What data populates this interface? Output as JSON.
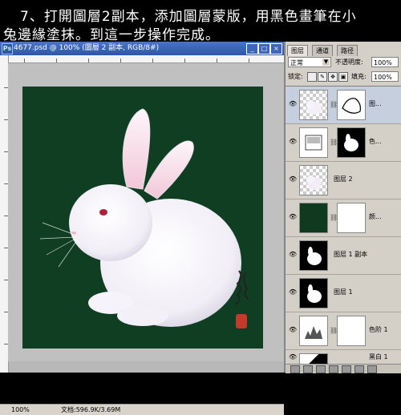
{
  "caption": {
    "line1": "7、打開圖層2副本，添加圖層蒙版，用黑色畫筆在小",
    "line2": "兔邊緣塗抹。到這一步操作完成。"
  },
  "document": {
    "title": "4677.psd @ 100% (圖層 2 副本, RGB/8#)",
    "zoom": "100%",
    "doc_info": "文档:596.9K/3.69M",
    "canvas_color": "#103e23"
  },
  "panel": {
    "tabs": [
      "图层",
      "通道",
      "路径"
    ],
    "blend_mode": "正常",
    "opacity_label": "不透明度:",
    "opacity": "100%",
    "lock_label": "锁定:",
    "fill_label": "填充:",
    "fill": "100%",
    "layers": [
      {
        "name": "图...",
        "selected": true
      },
      {
        "name": "色..."
      },
      {
        "name": "图层 2"
      },
      {
        "name": "颜..."
      },
      {
        "name": "图层 1 副本"
      },
      {
        "name": "图层 1"
      },
      {
        "name": "色阶 1"
      },
      {
        "name": "黑白 1"
      }
    ]
  }
}
